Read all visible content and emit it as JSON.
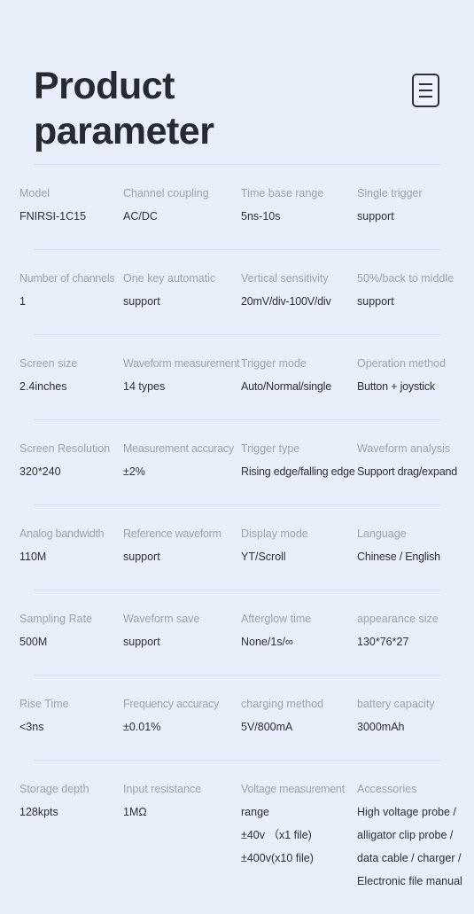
{
  "header": {
    "title": "Product\nparameter",
    "menu_icon": "document-list-icon"
  },
  "colors": {
    "background": "#e9eefb",
    "title_text": "#262b33",
    "label_text": "#9da2ad",
    "value_text": "#2c3038",
    "divider": "#d5dceb"
  },
  "rows": [
    {
      "cells": [
        {
          "label": "Model",
          "value": "FNIRSI-1C15"
        },
        {
          "label": "Channel coupling",
          "value": "AC/DC"
        },
        {
          "label": "Time base range",
          "value": "5ns-10s"
        },
        {
          "label": "Single trigger",
          "value": "support"
        }
      ]
    },
    {
      "cells": [
        {
          "label": "Number of channels",
          "value": "1"
        },
        {
          "label": "One key automatic",
          "value": "support"
        },
        {
          "label": "Vertical sensitivity",
          "value": "20mV/div-100V/div"
        },
        {
          "label": "50%/back to middle",
          "value": "support"
        }
      ]
    },
    {
      "cells": [
        {
          "label": "Screen size",
          "value": "2.4inches"
        },
        {
          "label": "Waveform measurement",
          "value": "14 types"
        },
        {
          "label": "Trigger mode",
          "value": "Auto/Normal/single"
        },
        {
          "label": "Operation method",
          "value": "Button + joystick"
        }
      ]
    },
    {
      "cells": [
        {
          "label": "Screen Resolution",
          "value": "320*240"
        },
        {
          "label": "Measurement accuracy",
          "value": "±2%"
        },
        {
          "label": "Trigger type",
          "value": "Rising edge/falling edge"
        },
        {
          "label": "Waveform analysis",
          "value": "Support drag/expand"
        }
      ]
    },
    {
      "cells": [
        {
          "label": "Analog bandwidth",
          "value": "110M"
        },
        {
          "label": "Reference waveform",
          "value": "support"
        },
        {
          "label": "Display mode",
          "value": "YT/Scroll"
        },
        {
          "label": "Language",
          "value": "Chinese / English"
        }
      ]
    },
    {
      "cells": [
        {
          "label": "Sampling Rate",
          "value": "500M"
        },
        {
          "label": "Waveform save",
          "value": "support"
        },
        {
          "label": "Afterglow time",
          "value": "None/1s/∞"
        },
        {
          "label": "appearance size",
          "value": "130*76*27"
        }
      ]
    },
    {
      "cells": [
        {
          "label": "Rise Time",
          "value": "<3ns"
        },
        {
          "label": "Frequency accuracy",
          "value": "±0.01%"
        },
        {
          "label": "charging method",
          "value": "5V/800mA"
        },
        {
          "label": "battery capacity",
          "value": "3000mAh"
        }
      ]
    },
    {
      "cells": [
        {
          "label": "Storage depth",
          "value": "128kpts"
        },
        {
          "label": "Input resistance",
          "value": "1MΩ"
        },
        {
          "label": "Voltage measurement",
          "value": "range\n±40v （x1 file)\n±400v(x10 file)"
        },
        {
          "label": "Accessories",
          "value": "High voltage probe /\nalligator clip probe /\ndata cable / charger /\n Electronic file manual"
        }
      ]
    }
  ]
}
